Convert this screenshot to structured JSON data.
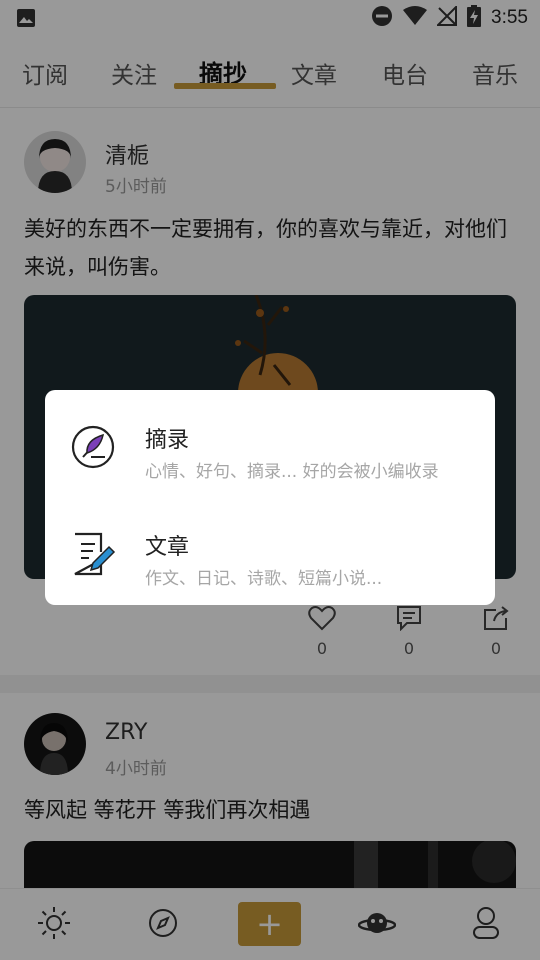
{
  "status_bar": {
    "time": "3:55"
  },
  "tabs": [
    {
      "label": "订阅",
      "active": false
    },
    {
      "label": "关注",
      "active": false
    },
    {
      "label": "摘抄",
      "active": true
    },
    {
      "label": "文章",
      "active": false
    },
    {
      "label": "电台",
      "active": false
    },
    {
      "label": "音乐",
      "active": false
    }
  ],
  "posts": [
    {
      "author": "清栀",
      "time_ago": "5小时前",
      "text": "美好的东西不一定要拥有，你的喜欢与靠近，对他们来说，叫伤害。",
      "likes": "0",
      "comments": "0",
      "shares": "0"
    },
    {
      "author": "ZRY",
      "time_ago": "4小时前",
      "text": "等风起 等花开 等我们再次相遇"
    }
  ],
  "dialog": {
    "options": [
      {
        "title": "摘录",
        "desc": "心情、好句、摘录... 好的会被小编收录",
        "icon": "quill-feather-icon"
      },
      {
        "title": "文章",
        "desc": "作文、日记、诗歌、短篇小说...",
        "icon": "document-pen-icon"
      }
    ]
  },
  "bottom_nav": {
    "items": [
      "sun-icon",
      "compass-icon",
      "add-icon",
      "planet-icon",
      "profile-icon"
    ],
    "add_label": "+"
  },
  "colors": {
    "accent": "#c79a3a",
    "icon_purple": "#7b3fb8",
    "icon_blue": "#2a8fd0"
  }
}
